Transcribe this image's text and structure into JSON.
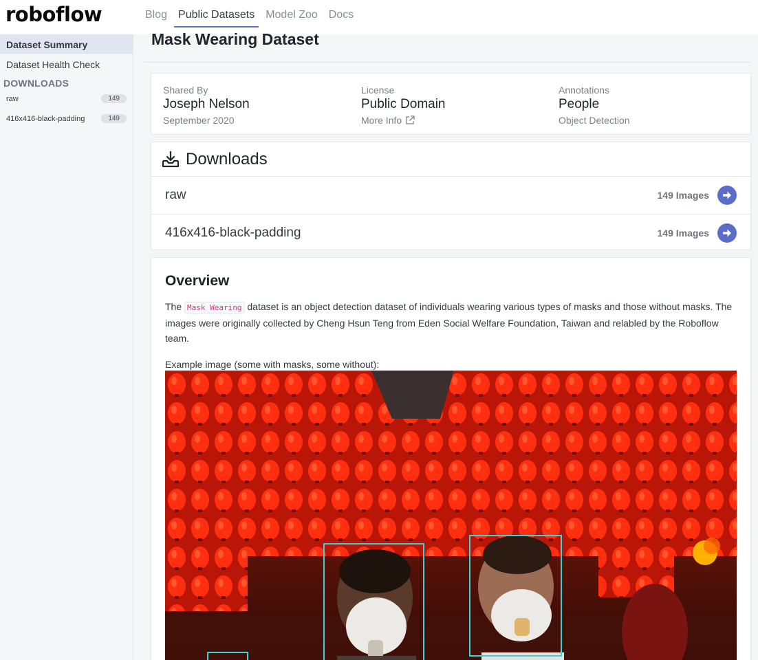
{
  "brand": {
    "logo": "roboflow"
  },
  "nav": {
    "links": [
      "Blog",
      "Public Datasets",
      "Model Zoo",
      "Docs"
    ]
  },
  "sidebar": {
    "items": [
      "Dataset Summary",
      "Dataset Health Check"
    ],
    "downloads_heading": "DOWNLOADS",
    "downloads": [
      {
        "name": "raw",
        "count": "149"
      },
      {
        "name": "416x416-black-padding",
        "count": "149"
      }
    ]
  },
  "page": {
    "title": "Mask Wearing Dataset"
  },
  "info": {
    "shared_by": {
      "label": "Shared By",
      "value": "Joseph Nelson",
      "sub": "September 2020"
    },
    "license": {
      "label": "License",
      "value": "Public Domain",
      "sub": "More Info"
    },
    "annotations": {
      "label": "Annotations",
      "value": "People",
      "sub": "Object Detection"
    }
  },
  "downloads": {
    "title": "Downloads",
    "rows": [
      {
        "name": "raw",
        "count": "149 Images"
      },
      {
        "name": "416x416-black-padding",
        "count": "149 Images"
      }
    ]
  },
  "overview": {
    "title": "Overview",
    "text_pre": "The ",
    "code": "Mask Wearing",
    "text_post": " dataset is an object detection dataset of individuals wearing various types of masks and those without masks. The images were originally collected by Cheng Hsun Teng from Eden Social Welfare Foundation, Taiwan and relabled by the Roboflow team.",
    "caption": "Example image (some with masks, some without):"
  },
  "colors": {
    "accent": "#5b6cc9",
    "bbox": "#3fd0d6",
    "lanterns": "#e8290e"
  }
}
